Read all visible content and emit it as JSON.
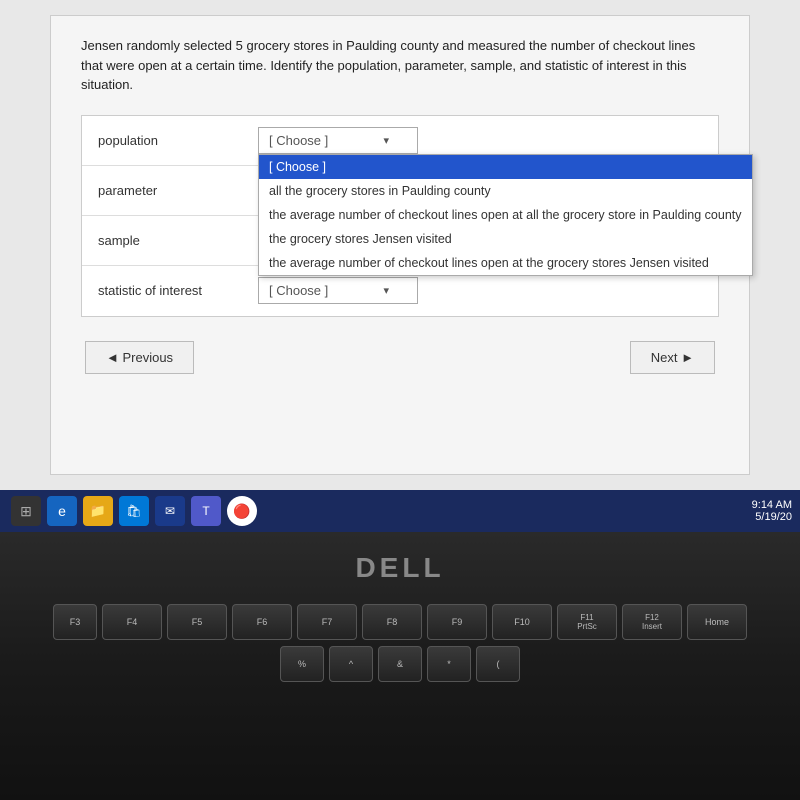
{
  "question": {
    "text": "Jensen randomly selected 5 grocery stores in Paulding county and measured the number of checkout lines that were open at a certain time. Identify the population, parameter, sample, and statistic of interest in this situation."
  },
  "form": {
    "rows": [
      {
        "label": "population",
        "value": "[ Choose ]"
      },
      {
        "label": "parameter",
        "value": "[ Choose ]"
      },
      {
        "label": "sample",
        "value": "[ Choose ]"
      },
      {
        "label": "statistic of interest",
        "value": "[ Choose ]"
      }
    ],
    "dropdown": {
      "open_for": "population",
      "options": [
        {
          "text": "[ Choose ]",
          "selected": true
        },
        {
          "text": "all the grocery stores in Paulding county",
          "selected": false
        },
        {
          "text": "the average number of checkout lines open at all the grocery store in Paulding county",
          "selected": false
        },
        {
          "text": "the grocery stores Jensen visited",
          "selected": false
        },
        {
          "text": "the average number of checkout lines open at the grocery stores Jensen visited",
          "selected": false
        }
      ]
    }
  },
  "navigation": {
    "previous_label": "◄ Previous",
    "next_label": "Next ►"
  },
  "taskbar": {
    "time": "9:14 AM",
    "date": "5/19/20"
  },
  "laptop": {
    "brand": "DELL"
  },
  "keyboard": {
    "rows": [
      [
        "F3",
        "F4",
        "F5",
        "F6",
        "F7",
        "F8",
        "F9",
        "F10",
        "F11 PrtSc",
        "F12 Insert",
        "Home"
      ],
      [
        "%",
        "^",
        "&",
        "*",
        "("
      ]
    ]
  }
}
